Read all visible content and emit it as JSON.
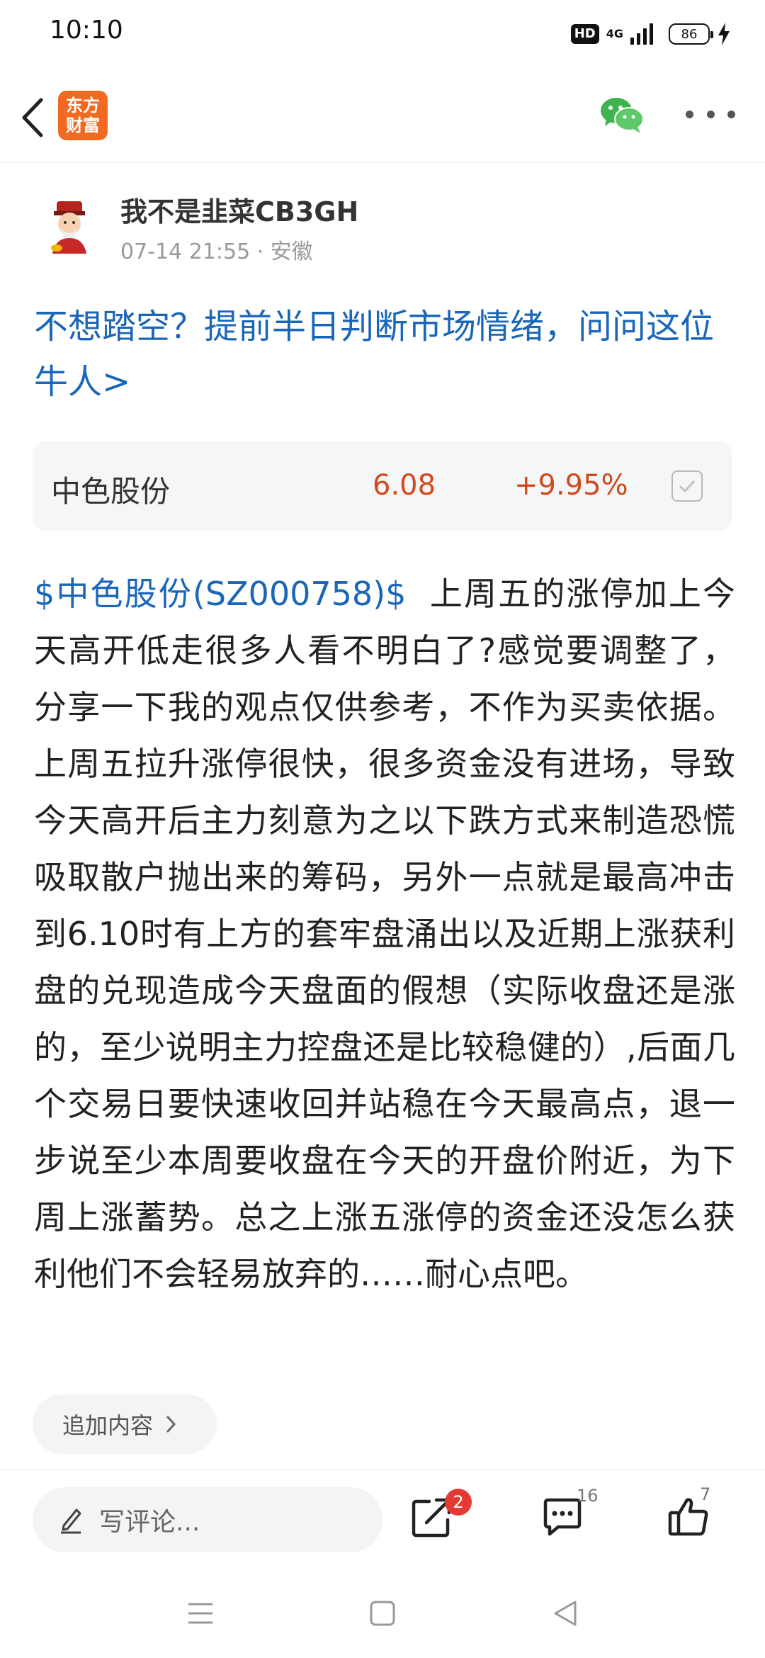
{
  "status_bar": {
    "time": "10:10",
    "hd_label": "HD",
    "network_label": "4G",
    "battery_level": "86"
  },
  "nav": {
    "logo_line1": "东方",
    "logo_line2": "财富",
    "brand_color": "#f26a21"
  },
  "author": {
    "name": "我不是韭菜CB3GH",
    "meta": "07-14 21:55 · 安徽"
  },
  "promo": {
    "text": "不想踏空？提前半日判断市场情绪，问问这位牛人>"
  },
  "stock": {
    "name": "中色股份",
    "price": "6.08",
    "change": "+9.95%",
    "rise_color": "#d14a1e"
  },
  "article": {
    "stock_tag": "$中色股份(SZ000758)$",
    "body": "上周五的涨停加上今天高开低走很多人看不明白了?感觉要调整了，分享一下我的观点仅供参考，不作为买卖依据。上周五拉升涨停很快，很多资金没有进场，导致今天高开后主力刻意为之以下跌方式来制造恐慌吸取散户抛出来的筹码，另外一点就是最高冲击到6.10时有上方的套牢盘涌出以及近期上涨获利盘的兑现造成今天盘面的假想（实际收盘还是涨的，至少说明主力控盘还是比较稳健的）,后面几个交易日要快速收回并站稳在今天最高点，退一步说至少本周要收盘在今天的开盘价附近，为下周上涨蓄势。总之上涨五涨停的资金还没怎么获利他们不会轻易放弃的……耐心点吧。"
  },
  "append": {
    "label": "追加内容"
  },
  "actions": {
    "comment_placeholder": "写评论...",
    "share_badge": "2",
    "comment_count": "16",
    "like_count": "7"
  },
  "icons": [
    "back-icon",
    "wechat-icon",
    "more-icon",
    "pencil-icon",
    "share-icon",
    "comment-icon",
    "thumbs-up-icon",
    "menu-icon",
    "home-icon",
    "back-triangle-icon"
  ]
}
